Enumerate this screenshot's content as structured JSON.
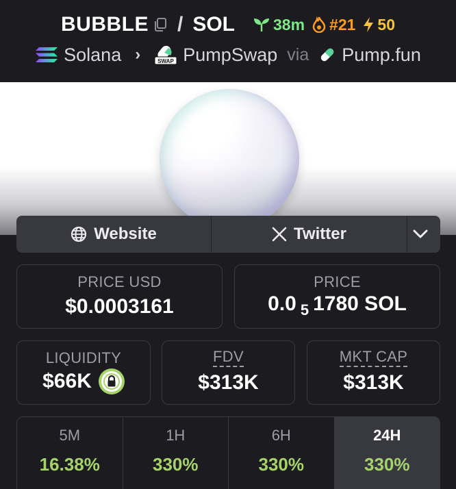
{
  "pair": {
    "base": "BUBBLE",
    "separator": "/",
    "quote": "SOL",
    "age": "38m",
    "trending_rank": "#21",
    "boosts": "50"
  },
  "breadcrumb": {
    "chain": "Solana",
    "dex": "PumpSwap",
    "dex_badge": "SWAP",
    "via_label": "via",
    "launchpad": "Pump.fun"
  },
  "links": {
    "website_label": "Website",
    "twitter_label": "Twitter"
  },
  "metrics": {
    "price_usd_label": "PRICE USD",
    "price_usd": "$0.0003161",
    "price_label": "PRICE",
    "price_prefix": "0.0",
    "price_zeros": "5",
    "price_rest": "1780 SOL",
    "liquidity_label": "LIQUIDITY",
    "liquidity": "$66K",
    "fdv_label": "FDV",
    "fdv": "$313K",
    "mktcap_label": "MKT CAP",
    "mktcap": "$313K"
  },
  "price_changes": [
    {
      "period": "5M",
      "change": "16.38%"
    },
    {
      "period": "1H",
      "change": "330%"
    },
    {
      "period": "6H",
      "change": "330%"
    },
    {
      "period": "24H",
      "change": "330%"
    }
  ],
  "colors": {
    "background": "#1b1b20",
    "positive": "#a5d36a",
    "age": "#7ee787",
    "rank": "#ff9a1f",
    "boost": "#f4c43c"
  },
  "selected_period": "24H"
}
